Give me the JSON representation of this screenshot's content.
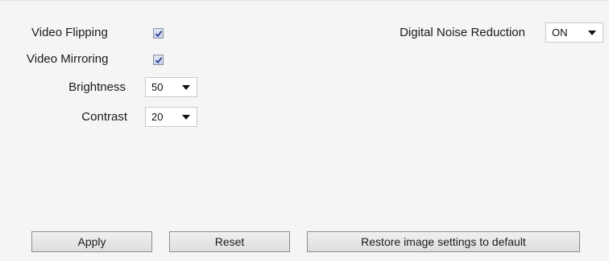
{
  "settings": {
    "video_flipping": {
      "label": "Video Flipping",
      "checked": true
    },
    "video_mirroring": {
      "label": "Video Mirroring",
      "checked": true
    },
    "brightness": {
      "label": "Brightness",
      "value": "50"
    },
    "contrast": {
      "label": "Contrast",
      "value": "20"
    },
    "digital_noise_reduction": {
      "label": "Digital Noise Reduction",
      "value": "ON"
    }
  },
  "buttons": {
    "apply": "Apply",
    "reset": "Reset",
    "restore": "Restore image settings to default"
  },
  "colors": {
    "panel_background": "#f5f5f5",
    "checkbox_fill": "#c7d3ee",
    "checkmark": "#2e3c8f"
  },
  "icons": {
    "checkbox_check": "checkmark-icon",
    "dropdown_arrow": "chevron-down-icon"
  }
}
